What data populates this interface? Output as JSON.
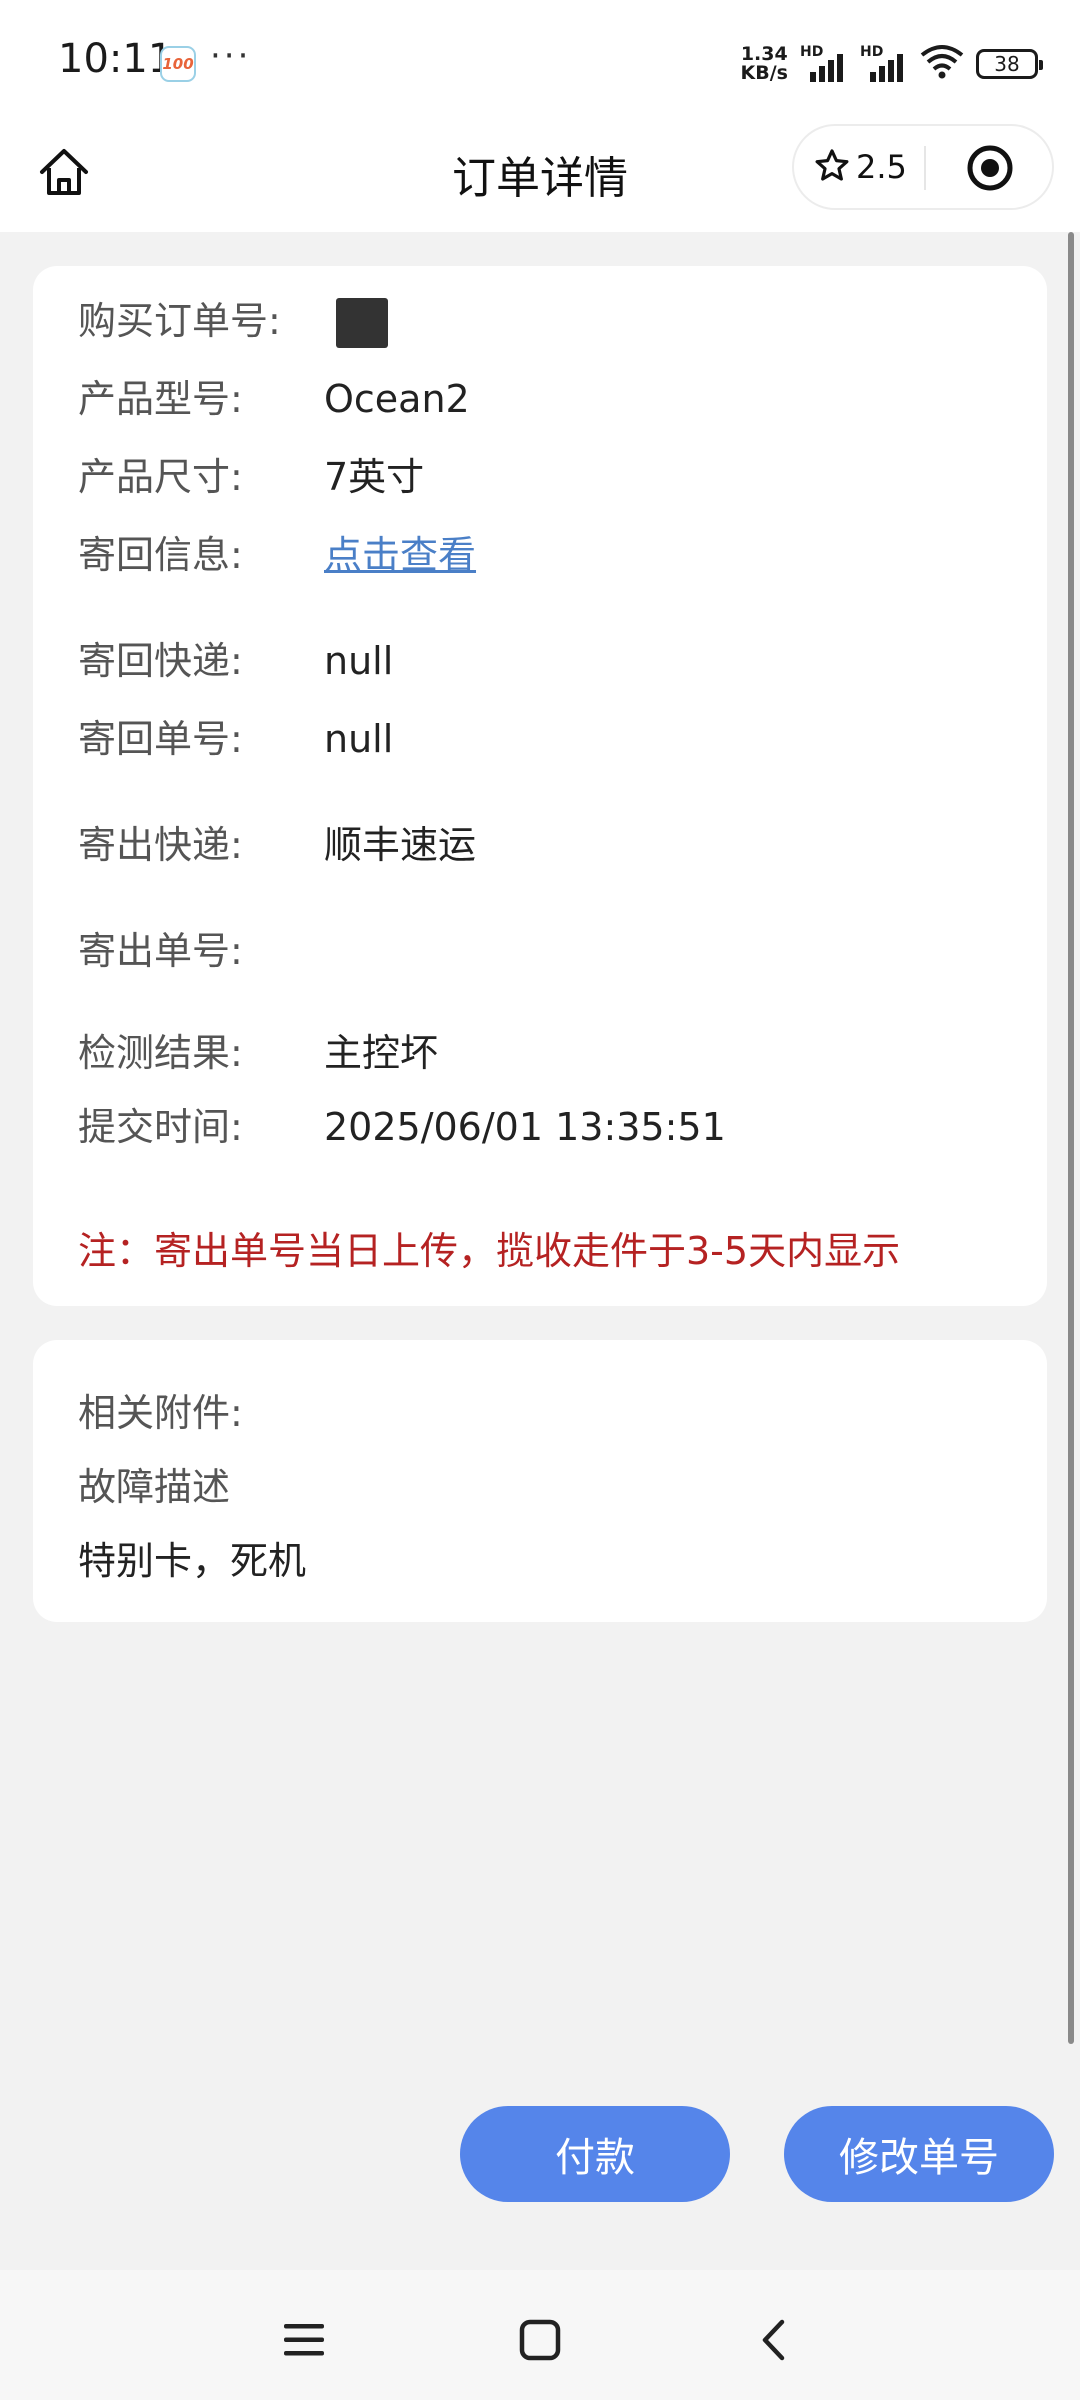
{
  "status_bar": {
    "time": "10:11",
    "app_badge": "100",
    "more": "···",
    "speed_value": "1.34",
    "speed_unit": "KB/s",
    "signal1_tag": "HD",
    "signal2_tag": "HD",
    "battery": "38"
  },
  "header": {
    "title": "订单详情",
    "rating": "2.5",
    "home_icon": "home-icon",
    "star_icon": "star-icon",
    "target_icon": "target-icon"
  },
  "order": {
    "order_no_label": "购买订单号:",
    "model_label": "产品型号:",
    "model_value": "Ocean2",
    "size_label": "产品尺寸:",
    "size_value": "7英寸",
    "return_info_label": "寄回信息:",
    "return_info_link": "点击查看",
    "return_courier_label": "寄回快递:",
    "return_courier_value": "null",
    "return_no_label": "寄回单号:",
    "return_no_value": "null",
    "send_courier_label": "寄出快递:",
    "send_courier_value": "顺丰速运",
    "send_no_label": "寄出单号:",
    "result_label": "检测结果:",
    "result_value": "主控坏",
    "submit_time_label": "提交时间:",
    "submit_time_value": "2025/06/01 13:35:51",
    "note": "注：寄出单号当日上传，揽收走件于3-5天内显示"
  },
  "attachments": {
    "label": "相关附件:",
    "fault_label": "故障描述",
    "fault_value": "特别卡，死机"
  },
  "actions": {
    "pay": "付款",
    "modify": "修改单号"
  },
  "colors": {
    "button": "#5585ea",
    "note": "#b52222",
    "link": "#4a7fc7",
    "background": "#f2f2f2"
  }
}
